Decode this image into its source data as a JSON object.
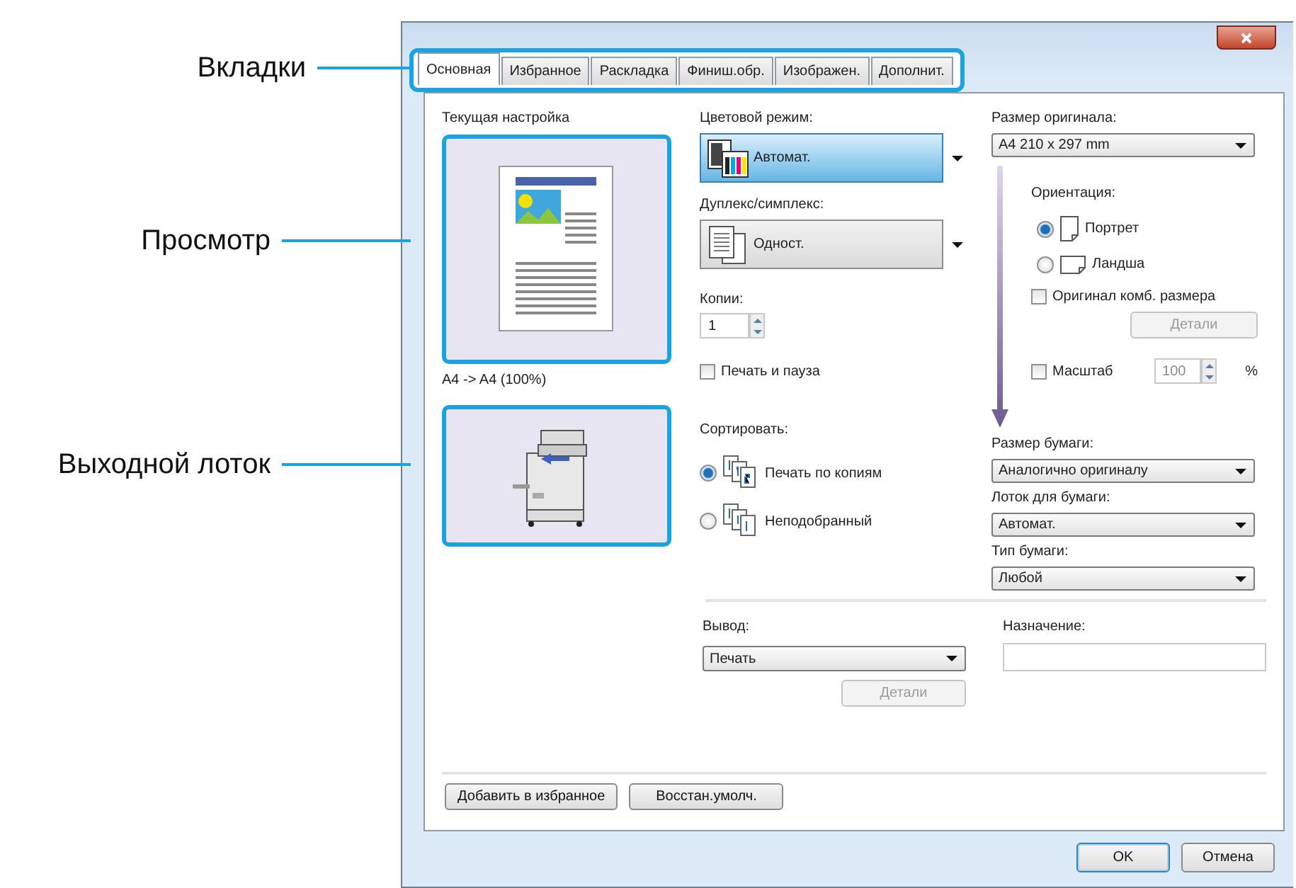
{
  "callouts": [
    {
      "label": "Вкладки"
    },
    {
      "label": "Просмотр"
    },
    {
      "label": "Выходной лоток"
    }
  ],
  "tabs": [
    {
      "label": "Основная",
      "selected": true
    },
    {
      "label": "Избранное",
      "selected": false
    },
    {
      "label": "Раскладка",
      "selected": false
    },
    {
      "label": "Финиш.обр.",
      "selected": false
    },
    {
      "label": "Изображен.",
      "selected": false
    },
    {
      "label": "Дополнит.",
      "selected": false
    }
  ],
  "preview": {
    "label": "Текущая настройка",
    "caption": "A4 -> A4 (100%)"
  },
  "color_mode": {
    "label": "Цветовой режим:",
    "value": "Автомат.",
    "selected": true
  },
  "duplex": {
    "label": "Дуплекс/симплекс:",
    "value": "Одност.",
    "selected": false
  },
  "copies": {
    "label": "Копии:",
    "value": "1"
  },
  "print_pause": {
    "label": "Печать и пауза",
    "checked": false
  },
  "sort": {
    "label": "Сортировать:",
    "options": [
      {
        "label": "Печать по копиям",
        "kind": "collated",
        "selected": true
      },
      {
        "label": "Неподобранный",
        "kind": "uncollated",
        "selected": false
      }
    ]
  },
  "original_size": {
    "label": "Размер оригинала:",
    "value": "A4 210 x 297 mm"
  },
  "orientation": {
    "label": "Ориентация:",
    "options": [
      {
        "label": "Портрет",
        "kind": "portrait",
        "selected": true
      },
      {
        "label": "Ландша",
        "kind": "landscape",
        "selected": false
      }
    ]
  },
  "mixed_size": {
    "label": "Оригинал комб. размера",
    "checked": false,
    "details_button": "Детали",
    "details_disabled": true
  },
  "zoom": {
    "label": "Масштаб",
    "checked": false,
    "value": "100",
    "unit": "%",
    "disabled": true
  },
  "paper": [
    {
      "label": "Размер бумаги:",
      "value": "Аналогично оригиналу"
    },
    {
      "label": "Лоток для бумаги:",
      "value": "Автомат."
    },
    {
      "label": "Тип бумаги:",
      "value": "Любой"
    }
  ],
  "output": {
    "label": "Вывод:",
    "value": "Печать",
    "details_button": "Детали",
    "details_disabled": true
  },
  "destination": {
    "label": "Назначение:"
  },
  "footer_buttons": [
    "Добавить в избранное",
    "Восстан.умолч."
  ],
  "dialog_buttons": [
    {
      "label": "OK",
      "default": true
    },
    {
      "label": "Отмена",
      "default": false
    }
  ]
}
